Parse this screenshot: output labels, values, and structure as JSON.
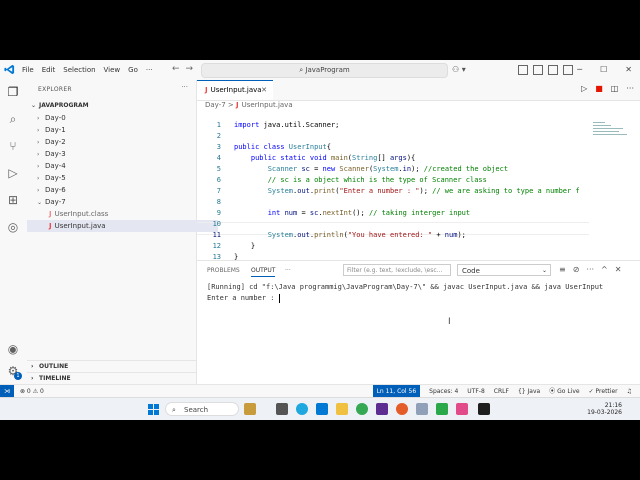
{
  "titlebar": {
    "menu": [
      "File",
      "Edit",
      "Selection",
      "View",
      "Go",
      "···"
    ],
    "search": "JavaProgram"
  },
  "sidebar": {
    "title": "EXPLORER",
    "more": "···",
    "root": "JAVAPROGRAM",
    "folders": [
      "Day-0",
      "Day-1",
      "Day-2",
      "Day-3",
      "Day-4",
      "Day-5",
      "Day-6",
      "Day-7"
    ],
    "files": [
      "UserInput.class",
      "UserInput.java"
    ],
    "outline": "OUTLINE",
    "timeline": "TIMELINE"
  },
  "editor": {
    "tab": "UserInput.java",
    "breadcrumb": [
      "Day-7",
      ">",
      "UserInput.java"
    ],
    "line_numbers": [
      "1",
      "2",
      "3",
      "4",
      "5",
      "6",
      "7",
      "8",
      "9",
      "10",
      "11",
      "12",
      "13"
    ]
  },
  "panel": {
    "tabs": [
      "PROBLEMS",
      "OUTPUT",
      "···"
    ],
    "filter_placeholder": "Filter (e.g. text, !exclude, \\esc...",
    "channel": "Code",
    "output_line1": "[Running] cd \"f:\\Java programmig\\JavaProgram\\Day-7\\\" && javac UserInput.java && java UserInput",
    "output_line2": "Enter a number : "
  },
  "statusbar": {
    "errors": "⊗ 0",
    "warnings": "⚠ 0",
    "position": "Ln 11, Col 56",
    "spaces": "Spaces: 4",
    "encoding": "UTF-8",
    "eol": "CRLF",
    "language": "Java",
    "golive": "Go Live",
    "prettier": "✓ Prettier"
  },
  "taskbar": {
    "search": "Search",
    "time": "21:16",
    "date": "19-03-2026"
  },
  "badges": {
    "settings": "1"
  },
  "colors": {
    "accent": "#005fb8",
    "java": "#e44444",
    "statusbar": "#f8f8f8"
  }
}
